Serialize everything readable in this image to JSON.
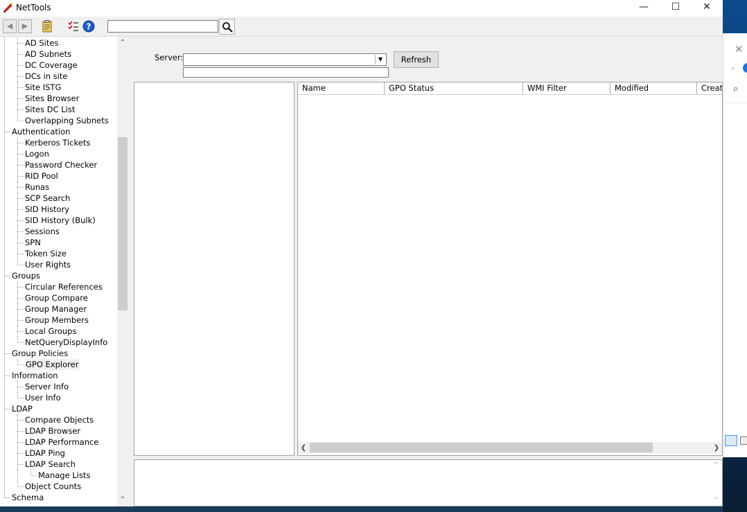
{
  "window": {
    "title": "NetTools",
    "minimize": "—",
    "maximize": "☐",
    "close": "✕"
  },
  "toolbar": {
    "search_value": "",
    "back": "◀",
    "forward": "▶"
  },
  "tree": {
    "items": [
      {
        "label": "AD Sites",
        "level": 2
      },
      {
        "label": "AD Subnets",
        "level": 2
      },
      {
        "label": "DC Coverage",
        "level": 2
      },
      {
        "label": "DCs in site",
        "level": 2
      },
      {
        "label": "Site ISTG",
        "level": 2
      },
      {
        "label": "Sites Browser",
        "level": 2
      },
      {
        "label": "Sites DC List",
        "level": 2
      },
      {
        "label": "Overlapping Subnets",
        "level": 2
      },
      {
        "label": "Authentication",
        "level": 1
      },
      {
        "label": "Kerberos Tickets",
        "level": 2
      },
      {
        "label": "Logon",
        "level": 2
      },
      {
        "label": "Password Checker",
        "level": 2
      },
      {
        "label": "RID Pool",
        "level": 2
      },
      {
        "label": "Runas",
        "level": 2
      },
      {
        "label": "SCP Search",
        "level": 2
      },
      {
        "label": "SID History",
        "level": 2
      },
      {
        "label": "SID History (Bulk)",
        "level": 2
      },
      {
        "label": "Sessions",
        "level": 2
      },
      {
        "label": "SPN",
        "level": 2
      },
      {
        "label": "Token Size",
        "level": 2
      },
      {
        "label": "User Rights",
        "level": 2
      },
      {
        "label": "Groups",
        "level": 1
      },
      {
        "label": "Circular References",
        "level": 2
      },
      {
        "label": "Group Compare",
        "level": 2
      },
      {
        "label": "Group Manager",
        "level": 2
      },
      {
        "label": "Group Members",
        "level": 2
      },
      {
        "label": "Local Groups",
        "level": 2
      },
      {
        "label": "NetQueryDisplayInfo",
        "level": 2
      },
      {
        "label": "Group Policies",
        "level": 1
      },
      {
        "label": "GPO Explorer",
        "level": 2,
        "selected": true
      },
      {
        "label": "Information",
        "level": 1
      },
      {
        "label": "Server Info",
        "level": 2
      },
      {
        "label": "User Info",
        "level": 2
      },
      {
        "label": "LDAP",
        "level": 1
      },
      {
        "label": "Compare Objects",
        "level": 2
      },
      {
        "label": "LDAP Browser",
        "level": 2
      },
      {
        "label": "LDAP Performance",
        "level": 2
      },
      {
        "label": "LDAP Ping",
        "level": 2
      },
      {
        "label": "LDAP Search",
        "level": 2
      },
      {
        "label": "Manage Lists",
        "level": 3
      },
      {
        "label": "Object Counts",
        "level": 2
      },
      {
        "label": "Schema",
        "level": 1
      }
    ]
  },
  "server": {
    "label": "Server:",
    "value": "",
    "secondary_value": ""
  },
  "refresh_label": "Refresh",
  "grid": {
    "columns": [
      "Name",
      "GPO Status",
      "WMI Filter",
      "Modified",
      "Created"
    ]
  }
}
